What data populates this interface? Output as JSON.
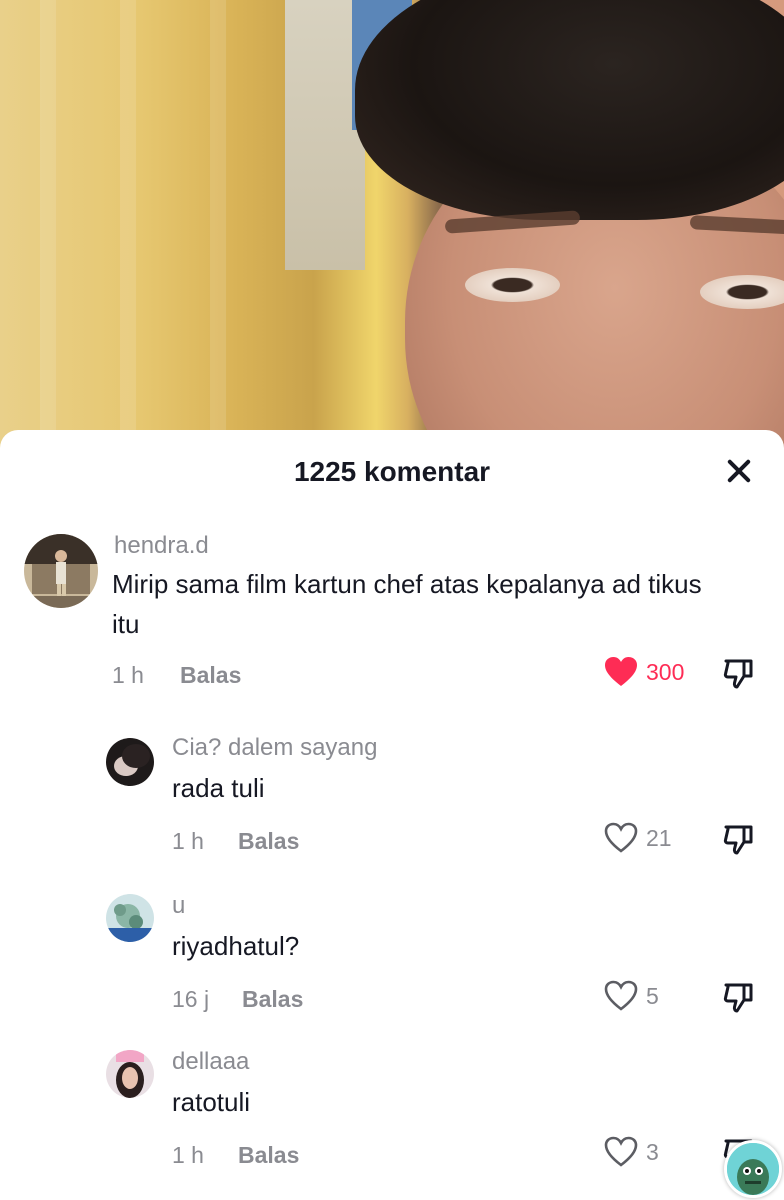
{
  "sheet": {
    "title": "1225 komentar"
  },
  "comments": [
    {
      "username": "hendra.d",
      "text_line1": "Mirip sama film kartun chef atas kepalanya ad tikus",
      "text_line2": "itu",
      "time": "1 h",
      "reply": "Balas",
      "likes": "300",
      "liked": true
    },
    {
      "username": "Cia? dalem sayang",
      "text": "rada tuli",
      "time": "1 h",
      "reply": "Balas",
      "likes": "21",
      "liked": false
    },
    {
      "username": "u",
      "text": "riyadhatul?",
      "time": "16 j",
      "reply": "Balas",
      "likes": "5",
      "liked": false
    },
    {
      "username": "dellaaa",
      "text": "ratotuli",
      "time": "1 h",
      "reply": "Balas",
      "likes": "3",
      "liked": false
    }
  ],
  "colors": {
    "liked": "#fe2c55",
    "muted": "#8a8b91",
    "text": "#161823"
  },
  "icons": {
    "close": "close-icon",
    "heart": "heart-icon",
    "dislike": "dislike-icon"
  }
}
